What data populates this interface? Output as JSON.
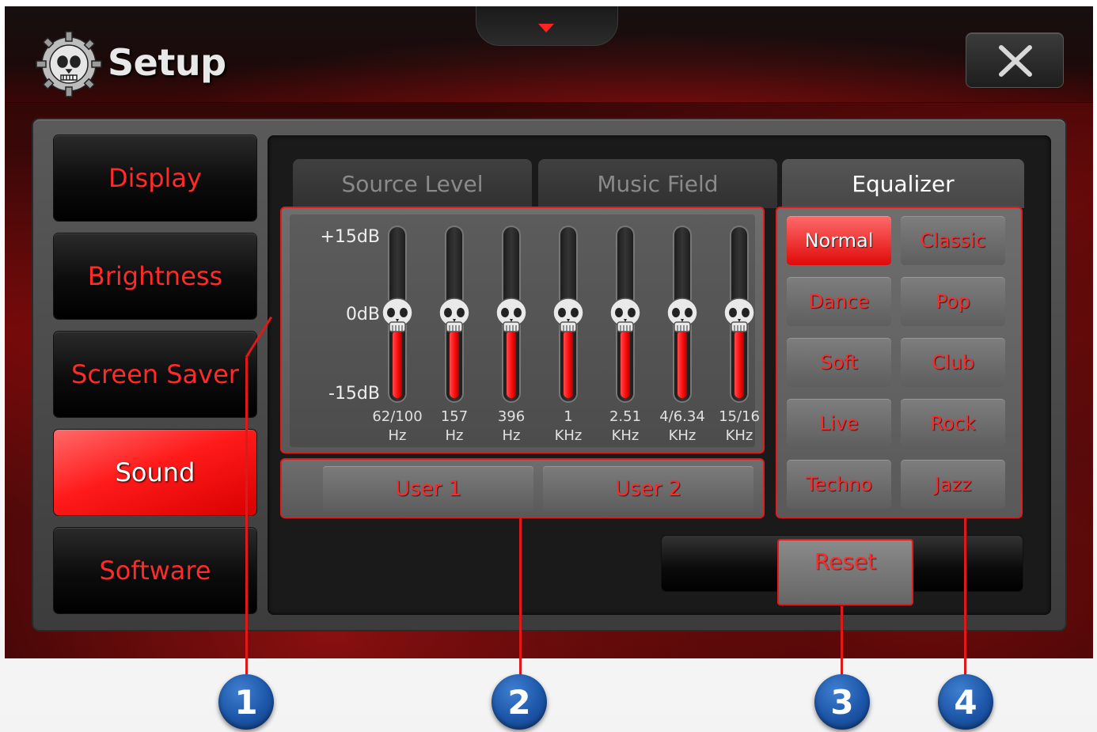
{
  "app": {
    "title": "Setup",
    "close_label": "close"
  },
  "sidebar": {
    "items": [
      {
        "label": "Display",
        "active": false
      },
      {
        "label": "Brightness",
        "active": false
      },
      {
        "label": "Screen Saver",
        "active": false
      },
      {
        "label": "Sound",
        "active": true
      },
      {
        "label": "Software",
        "active": false
      }
    ]
  },
  "tabs": [
    {
      "label": "Source Level",
      "active": false
    },
    {
      "label": "Music Field",
      "active": false
    },
    {
      "label": "Equalizer",
      "active": true
    }
  ],
  "equalizer": {
    "db_labels": [
      "+15dB",
      "0dB",
      "-15dB"
    ],
    "bands": [
      {
        "freq": "62/100",
        "unit": "Hz",
        "level_db": 0
      },
      {
        "freq": "157",
        "unit": "Hz",
        "level_db": 0
      },
      {
        "freq": "396",
        "unit": "Hz",
        "level_db": 0
      },
      {
        "freq": "1",
        "unit": "KHz",
        "level_db": 0
      },
      {
        "freq": "2.51",
        "unit": "KHz",
        "level_db": 0
      },
      {
        "freq": "4/6.34",
        "unit": "KHz",
        "level_db": 0
      },
      {
        "freq": "15/16",
        "unit": "KHz",
        "level_db": 0
      }
    ]
  },
  "user_presets": [
    "User 1",
    "User 2"
  ],
  "presets": [
    {
      "label": "Normal",
      "active": true
    },
    {
      "label": "Classic",
      "active": false
    },
    {
      "label": "Dance",
      "active": false
    },
    {
      "label": "Pop",
      "active": false
    },
    {
      "label": "Soft",
      "active": false
    },
    {
      "label": "Club",
      "active": false
    },
    {
      "label": "Live",
      "active": false
    },
    {
      "label": "Rock",
      "active": false
    },
    {
      "label": "Techno",
      "active": false
    },
    {
      "label": "Jazz",
      "active": false
    }
  ],
  "reset_label": "Reset",
  "callouts": [
    "1",
    "2",
    "3",
    "4"
  ],
  "colors": {
    "accent": "#ff2a2a",
    "callout": "#1d56a8"
  }
}
